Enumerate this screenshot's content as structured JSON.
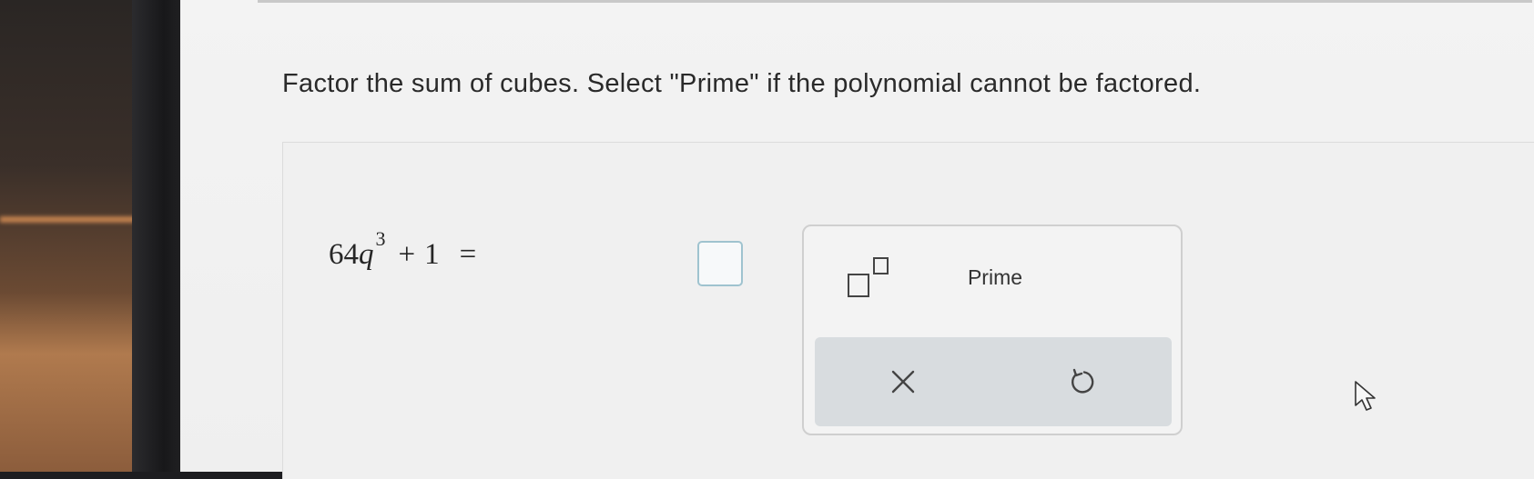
{
  "question": {
    "text": "Factor the sum of cubes. Select \"Prime\" if the polynomial cannot be factored."
  },
  "equation": {
    "coefficient": "64",
    "variable": "q",
    "exponent": "3",
    "operator": "+",
    "constant": "1",
    "equals": "="
  },
  "answer": {
    "value": ""
  },
  "palette": {
    "exponent_template_icon": "superscript-template-icon",
    "prime_label": "Prime",
    "clear_icon": "close-icon",
    "undo_icon": "undo-icon"
  },
  "colors": {
    "answer_box_border": "#9fc3cf",
    "action_bar": "#d8dcdf",
    "text": "#2a2a2a"
  }
}
